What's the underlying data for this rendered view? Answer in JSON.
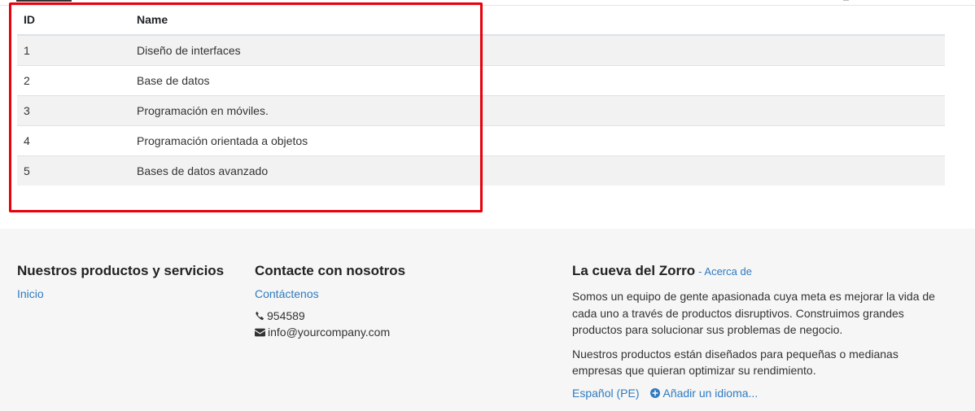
{
  "table": {
    "headers": {
      "id": "ID",
      "name": "Name"
    },
    "rows": [
      {
        "id": "1",
        "name": "Diseño de interfaces"
      },
      {
        "id": "2",
        "name": "Base de datos"
      },
      {
        "id": "3",
        "name": "Programación en móviles."
      },
      {
        "id": "4",
        "name": "Programación orientada a objetos"
      },
      {
        "id": "5",
        "name": "Bases de datos avanzado"
      }
    ]
  },
  "highlight_color": "#e8000b",
  "footer": {
    "products": {
      "title": "Nuestros productos y servicios",
      "link": "Inicio"
    },
    "contact": {
      "title": "Contacte con nosotros",
      "link": "Contáctenos",
      "phone": "954589",
      "email": "info@yourcompany.com",
      "phone_icon": "phone-icon",
      "email_icon": "envelope-icon"
    },
    "about": {
      "title": "La cueva del Zorro",
      "about_link": "- Acerca de",
      "p1": "Somos un equipo de gente apasionada cuya meta es mejorar la vida de cada uno a través de productos disruptivos. Construimos grandes productos para solucionar sus problemas de negocio.",
      "p2": "Nuestros productos están diseñados para pequeñas o medianas empresas que quieran optimizar su rendimiento.",
      "language": "Español (PE)",
      "add_language": "Añadir un idioma...",
      "add_icon": "plus-circle-icon"
    }
  },
  "colors": {
    "link": "#2f7bc0",
    "footer_bg": "#f6f6f6",
    "stripe": "#f2f2f2"
  }
}
